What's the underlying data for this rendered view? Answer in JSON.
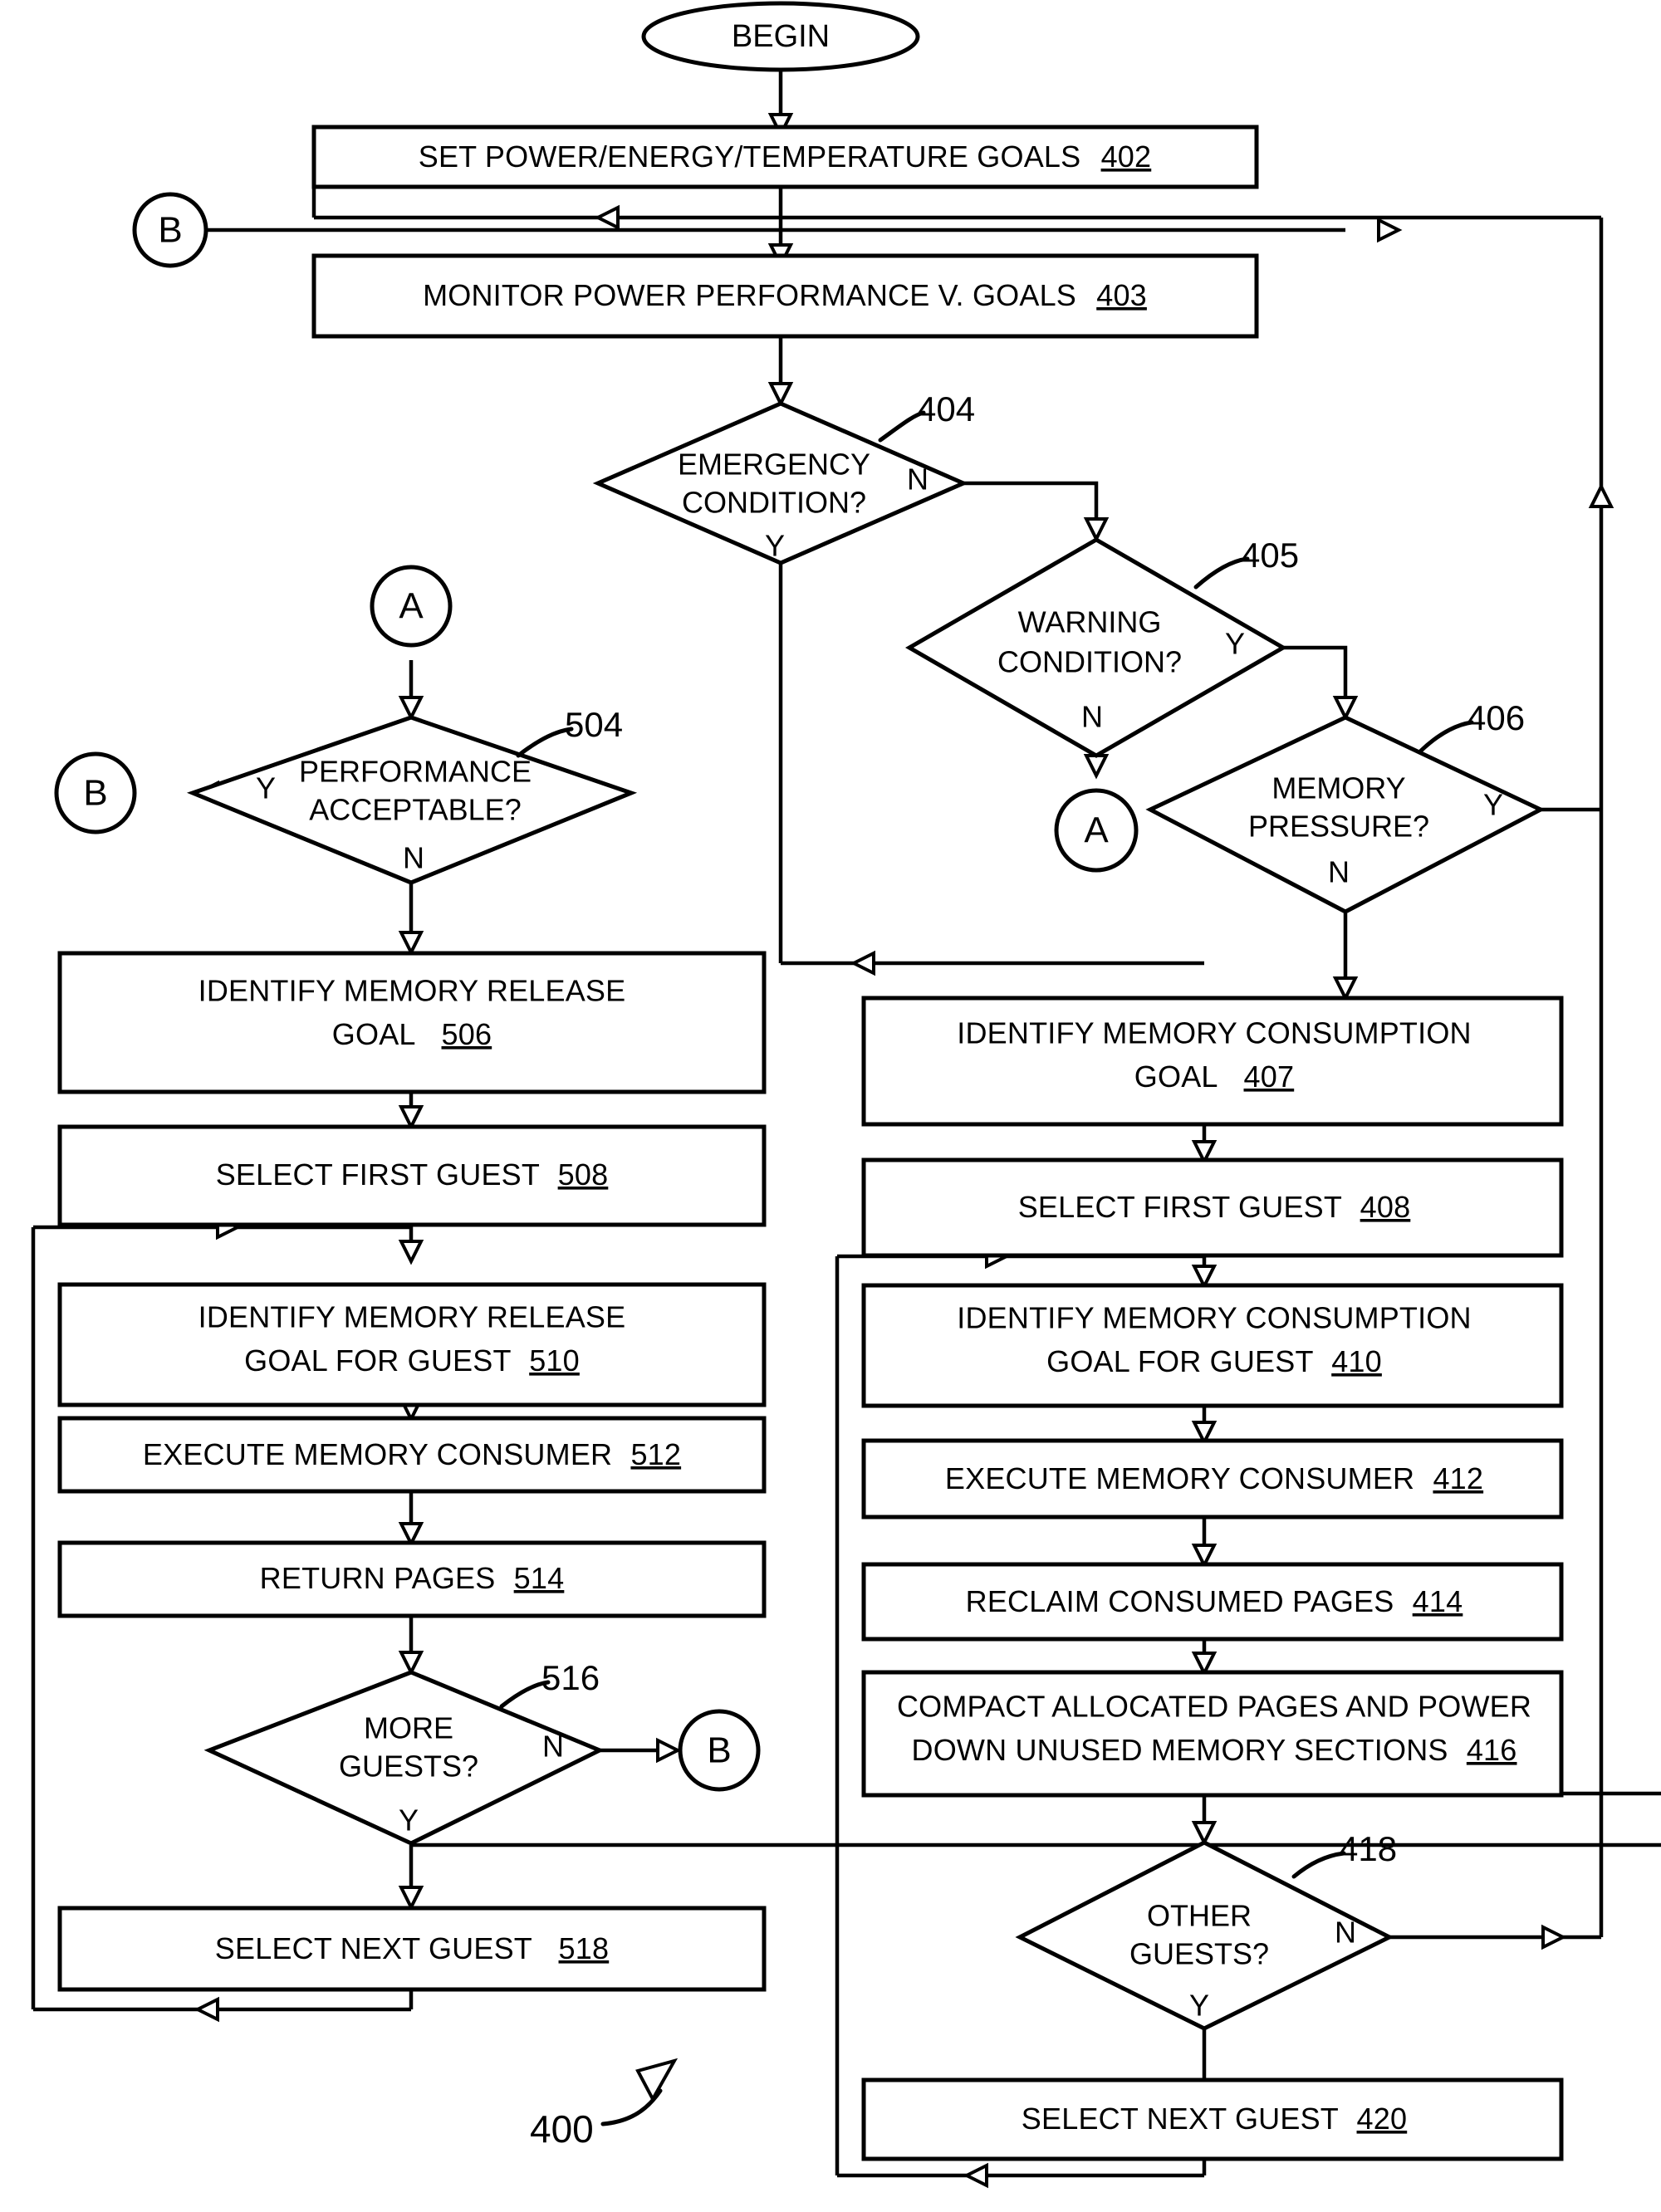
{
  "figure": {
    "label": "400",
    "terminal_begin": "BEGIN"
  },
  "connectors": {
    "b_top": "B",
    "b_left": "B",
    "b_more_guests": "B",
    "a_left": "A",
    "a_right": "A"
  },
  "nodes": {
    "n402": {
      "text": "SET POWER/ENERGY/TEMPERATURE GOALS",
      "ref": "402",
      "type": "process"
    },
    "n403": {
      "text": "MONITOR POWER PERFORMANCE V. GOALS",
      "ref": "403",
      "type": "process"
    },
    "n404": {
      "line1": "EMERGENCY",
      "line2": "CONDITION?",
      "ref": "404",
      "type": "decision",
      "yes": "Y",
      "no": "N"
    },
    "n405": {
      "line1": "WARNING",
      "line2": "CONDITION?",
      "ref": "405",
      "type": "decision",
      "yes": "Y",
      "no": "N"
    },
    "n406": {
      "line1": "MEMORY",
      "line2": "PRESSURE?",
      "ref": "406",
      "type": "decision",
      "yes": "Y",
      "no": "N"
    },
    "n407": {
      "line1": "IDENTIFY MEMORY CONSUMPTION",
      "line2": "GOAL",
      "ref": "407",
      "type": "process"
    },
    "n408": {
      "text": "SELECT FIRST GUEST",
      "ref": "408",
      "type": "process"
    },
    "n410": {
      "line1": "IDENTIFY MEMORY CONSUMPTION",
      "line2": "GOAL FOR GUEST",
      "ref": "410",
      "type": "process"
    },
    "n412": {
      "text": "EXECUTE MEMORY CONSUMER",
      "ref": "412",
      "type": "process"
    },
    "n414": {
      "text": "RECLAIM CONSUMED PAGES",
      "ref": "414",
      "type": "process"
    },
    "n416": {
      "line1": "COMPACT ALLOCATED PAGES AND POWER",
      "line2": "DOWN UNUSED MEMORY SECTIONS",
      "ref": "416",
      "type": "process"
    },
    "n418": {
      "line1": "OTHER",
      "line2": "GUESTS?",
      "ref": "418",
      "type": "decision",
      "yes": "Y",
      "no": "N"
    },
    "n420": {
      "text": "SELECT NEXT GUEST",
      "ref": "420",
      "type": "process"
    },
    "n504": {
      "line1": "PERFORMANCE",
      "line2": "ACCEPTABLE?",
      "ref": "504",
      "type": "decision",
      "yes": "Y",
      "no": "N"
    },
    "n506": {
      "line1": "IDENTIFY MEMORY RELEASE",
      "line2": "GOAL",
      "ref": "506",
      "type": "process"
    },
    "n508": {
      "text": "SELECT FIRST GUEST",
      "ref": "508",
      "type": "process"
    },
    "n510": {
      "line1": "IDENTIFY MEMORY RELEASE",
      "line2": "GOAL FOR GUEST",
      "ref": "510",
      "type": "process"
    },
    "n512": {
      "text": "EXECUTE MEMORY CONSUMER",
      "ref": "512",
      "type": "process"
    },
    "n514": {
      "text": "RETURN PAGES",
      "ref": "514",
      "type": "process"
    },
    "n516": {
      "line1": "MORE",
      "line2": "GUESTS?",
      "ref": "516",
      "type": "decision",
      "yes": "Y",
      "no": "N"
    },
    "n518": {
      "text": "SELECT NEXT GUEST",
      "ref": "518",
      "type": "process"
    }
  },
  "colors": {
    "ink": "#000000",
    "paper": "#ffffff"
  }
}
